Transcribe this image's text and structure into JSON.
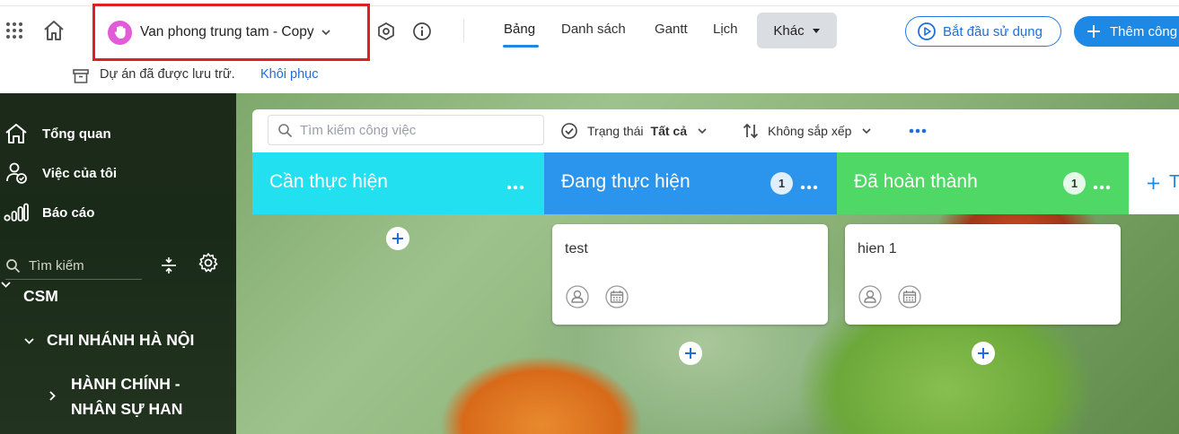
{
  "header": {
    "project_name": "Van phong trung tam - Copy",
    "tabs": [
      {
        "label": "Bảng",
        "active": true
      },
      {
        "label": "Danh sách"
      },
      {
        "label": "Gantt"
      },
      {
        "label": "Lịch"
      }
    ],
    "more_label": "Khác",
    "start_label": "Bắt đầu sử dụng",
    "add_label": "Thêm công",
    "accent_color": "#1e88e5"
  },
  "archive": {
    "message": "Dự án đã được lưu trữ.",
    "restore_label": "Khôi phục"
  },
  "sidebar": {
    "nav": [
      {
        "label": "Tổng quan",
        "icon": "home-icon"
      },
      {
        "label": "Việc của tôi",
        "icon": "my-tasks-icon"
      },
      {
        "label": "Báo cáo",
        "icon": "report-icon"
      }
    ],
    "search_placeholder": "Tìm kiếm",
    "tree": {
      "root": "CSM",
      "branch": "CHI NHÁNH HÀ NỘI",
      "dept_line1": "HÀNH CHÍNH -",
      "dept_line2": "NHÂN SỰ HAN"
    }
  },
  "toolbar": {
    "search_placeholder": "Tìm kiếm công việc",
    "status_label": "Trạng thái",
    "status_value": "Tất cả",
    "sort_label": "Không sắp xếp"
  },
  "columns": [
    {
      "title": "Cần thực hiện",
      "color": "#22e0f0",
      "count": null,
      "cards": []
    },
    {
      "title": "Đang thực hiện",
      "color": "#2b95ee",
      "count": "1",
      "cards": [
        {
          "title": "test"
        }
      ]
    },
    {
      "title": "Đã hoàn thành",
      "color": "#4fd866",
      "count": "1",
      "cards": [
        {
          "title": "hien 1"
        }
      ]
    }
  ],
  "add_column_label": "T"
}
